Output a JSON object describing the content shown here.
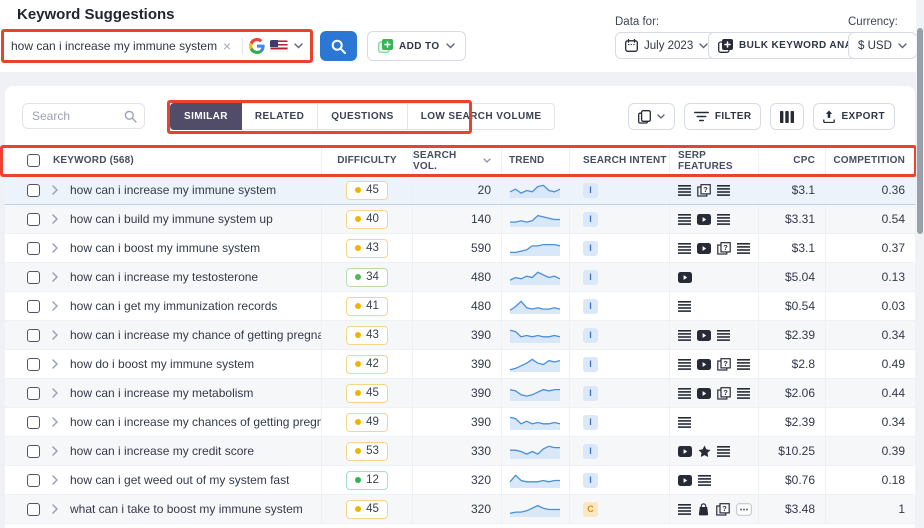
{
  "title": "Keyword Suggestions",
  "search": {
    "query": "how can i increase my immune system",
    "clear_icon": "×",
    "add_to_label": "ADD TO"
  },
  "data_for": {
    "label": "Data for:",
    "value": "July 2023"
  },
  "bulk_analysis_label": "BULK KEYWORD ANALYSIS",
  "currency": {
    "label": "Currency:",
    "value": "$ USD"
  },
  "toolbar": {
    "search_placeholder": "Search",
    "tabs": [
      "SIMILAR",
      "RELATED",
      "QUESTIONS",
      "LOW SEARCH VOLUME"
    ],
    "active_tab": "SIMILAR",
    "filter_label": "FILTER",
    "export_label": "EXPORT"
  },
  "table": {
    "header": {
      "keyword": "KEYWORD (568)",
      "difficulty": "DIFFICULTY",
      "volume": "SEARCH VOL.",
      "trend": "TREND",
      "intent": "SEARCH INTENT",
      "serp": "SERP FEATURES",
      "cpc": "CPC",
      "competition": "COMPETITION"
    },
    "rows": [
      {
        "keyword": "how can i increase my immune system",
        "difficulty": 45,
        "difficulty_level": "yellow",
        "volume": "20",
        "trend": [
          4,
          6,
          3,
          5,
          4,
          8,
          9,
          5,
          4,
          6
        ],
        "intent": "I",
        "intent_type": "informational",
        "serp_features": [
          "lines",
          "paa",
          "lines"
        ],
        "cpc": "$3.1",
        "competition": "0.36",
        "highlighted": true
      },
      {
        "keyword": "how can i build my immune system up",
        "difficulty": 40,
        "difficulty_level": "yellow",
        "volume": "140",
        "trend": [
          3,
          3,
          4,
          3,
          4,
          8,
          7,
          6,
          5,
          5
        ],
        "intent": "I",
        "intent_type": "informational",
        "serp_features": [
          "lines",
          "video",
          "lines"
        ],
        "cpc": "$3.31",
        "competition": "0.54",
        "highlighted": false
      },
      {
        "keyword": "how can i boost my immune system",
        "difficulty": 43,
        "difficulty_level": "yellow",
        "volume": "590",
        "trend": [
          2,
          2,
          3,
          4,
          7,
          7,
          8,
          8,
          8,
          7
        ],
        "intent": "I",
        "intent_type": "informational",
        "serp_features": [
          "lines",
          "video",
          "paa",
          "lines"
        ],
        "cpc": "$3.1",
        "competition": "0.37",
        "highlighted": false
      },
      {
        "keyword": "how can i increase my testosterone",
        "difficulty": 34,
        "difficulty_level": "green",
        "volume": "480",
        "trend": [
          3,
          5,
          4,
          6,
          5,
          9,
          7,
          5,
          6,
          4
        ],
        "intent": "I",
        "intent_type": "informational",
        "serp_features": [
          "video"
        ],
        "cpc": "$5.04",
        "competition": "0.13",
        "highlighted": false
      },
      {
        "keyword": "how can i get my immunization records",
        "difficulty": 41,
        "difficulty_level": "yellow",
        "volume": "480",
        "trend": [
          2,
          5,
          9,
          4,
          3,
          4,
          3,
          3,
          4,
          3
        ],
        "intent": "I",
        "intent_type": "informational",
        "serp_features": [
          "lines"
        ],
        "cpc": "$0.54",
        "competition": "0.03",
        "highlighted": false
      },
      {
        "keyword": "how can i increase my chance of getting pregnant",
        "difficulty": 43,
        "difficulty_level": "yellow",
        "volume": "390",
        "trend": [
          9,
          8,
          4,
          5,
          4,
          5,
          4,
          4,
          5,
          4
        ],
        "intent": "I",
        "intent_type": "informational",
        "serp_features": [
          "lines",
          "video",
          "lines"
        ],
        "cpc": "$2.39",
        "competition": "0.34",
        "highlighted": false
      },
      {
        "keyword": "how do i boost my immune system",
        "difficulty": 42,
        "difficulty_level": "yellow",
        "volume": "390",
        "trend": [
          1,
          2,
          4,
          6,
          9,
          6,
          5,
          8,
          7,
          8
        ],
        "intent": "I",
        "intent_type": "informational",
        "serp_features": [
          "lines",
          "video",
          "paa",
          "lines"
        ],
        "cpc": "$2.8",
        "competition": "0.49",
        "highlighted": false
      },
      {
        "keyword": "how can i increase my metabolism",
        "difficulty": 45,
        "difficulty_level": "yellow",
        "volume": "390",
        "trend": [
          8,
          7,
          4,
          3,
          4,
          6,
          8,
          7,
          8,
          8
        ],
        "intent": "I",
        "intent_type": "informational",
        "serp_features": [
          "lines",
          "video",
          "paa",
          "lines"
        ],
        "cpc": "$2.06",
        "competition": "0.44",
        "highlighted": false
      },
      {
        "keyword": "how can i increase my chances of getting pregnant",
        "difficulty": 49,
        "difficulty_level": "yellow",
        "volume": "390",
        "trend": [
          9,
          8,
          4,
          6,
          4,
          5,
          4,
          4,
          5,
          4
        ],
        "intent": "I",
        "intent_type": "informational",
        "serp_features": [
          "lines"
        ],
        "cpc": "$2.39",
        "competition": "0.34",
        "highlighted": false
      },
      {
        "keyword": "how can i increase my credit score",
        "difficulty": 53,
        "difficulty_level": "yellow",
        "volume": "330",
        "trend": [
          6,
          6,
          5,
          3,
          5,
          3,
          7,
          9,
          8,
          8
        ],
        "intent": "I",
        "intent_type": "informational",
        "serp_features": [
          "video",
          "star",
          "lines"
        ],
        "cpc": "$10.25",
        "competition": "0.39",
        "highlighted": false
      },
      {
        "keyword": "how can i get weed out of my system fast",
        "difficulty": 12,
        "difficulty_level": "teal",
        "volume": "320",
        "trend": [
          4,
          9,
          5,
          4,
          4,
          4,
          5,
          4,
          5,
          5
        ],
        "intent": "I",
        "intent_type": "informational",
        "serp_features": [
          "video",
          "lines"
        ],
        "cpc": "$0.76",
        "competition": "0.18",
        "highlighted": false
      },
      {
        "keyword": "what can i take to boost my immune system",
        "difficulty": 45,
        "difficulty_level": "yellow",
        "volume": "320",
        "trend": [
          2,
          3,
          3,
          4,
          6,
          8,
          6,
          5,
          5,
          5
        ],
        "intent": "C",
        "intent_type": "commercial",
        "serp_features": [
          "lines",
          "bag",
          "paa",
          "more"
        ],
        "cpc": "$3.48",
        "competition": "1",
        "highlighted": false
      }
    ]
  },
  "colors": {
    "annotation_red": "#e8432d",
    "accent_blue": "#2b77d3",
    "active_tab_purple": "#514c68",
    "trend_line": "#4a8fd8",
    "trend_fill": "#d9e8f8"
  }
}
